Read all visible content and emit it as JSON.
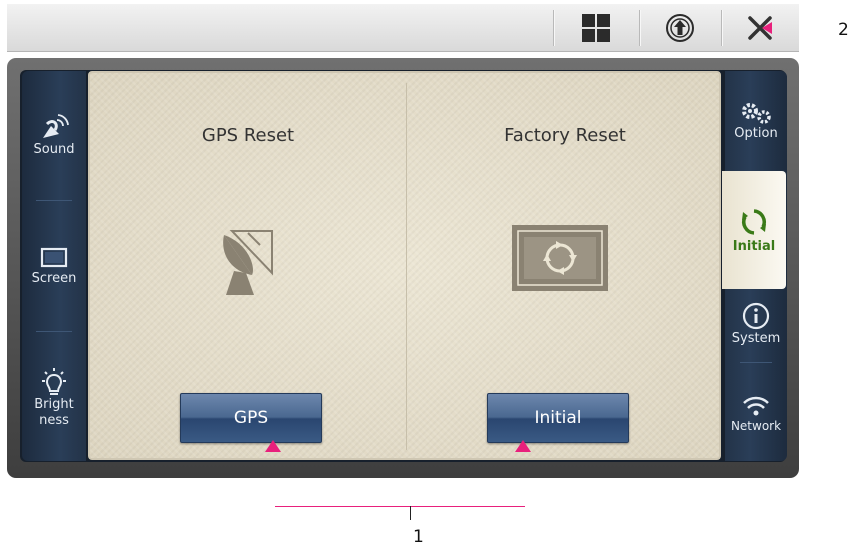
{
  "top_bar": {
    "buttons": [
      "grid-icon",
      "upload-icon",
      "close-icon"
    ]
  },
  "left_tabs": [
    {
      "label": "Sound",
      "icon": "satellite-signal-icon"
    },
    {
      "label": "Screen",
      "icon": "screen-icon"
    },
    {
      "label_line1": "Bright",
      "label_line2": "ness",
      "icon": "bulb-icon"
    }
  ],
  "right_tabs": [
    {
      "label": "Option",
      "icon": "gears-icon"
    },
    {
      "label": "Initial",
      "icon": "refresh-icon",
      "active": true
    },
    {
      "label": "System",
      "icon": "info-icon"
    },
    {
      "label": "Network",
      "icon": "wifi-icon"
    }
  ],
  "sections": [
    {
      "title": "GPS Reset",
      "button": "GPS",
      "icon": "satellite-dish-icon"
    },
    {
      "title": "Factory Reset",
      "button": "Initial",
      "icon": "reset-icon"
    }
  ],
  "callouts": {
    "bottom": "1",
    "right": "2"
  },
  "colors": {
    "accent": "#e8207c",
    "active_tab_text": "#3a7a18",
    "button": "#4a6890"
  }
}
